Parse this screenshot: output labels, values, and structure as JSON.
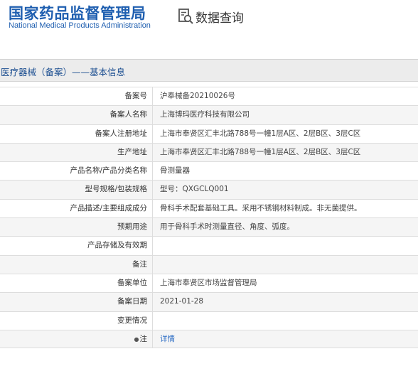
{
  "header": {
    "brand_cn": "国家药品监督管理局",
    "brand_en": "National Medical Products Administration",
    "query_label": "数据查询",
    "query_icon": "document-search-icon"
  },
  "page": {
    "title": "医疗器械（备案）——基本信息"
  },
  "rows": [
    {
      "label": "备案号",
      "value": "沪奉械备20210026号"
    },
    {
      "label": "备案人名称",
      "value": "上海博玛医疗科技有限公司"
    },
    {
      "label": "备案人注册地址",
      "value": "上海市奉贤区汇丰北路788号一幢1层A区、2层B区、3层C区"
    },
    {
      "label": "生产地址",
      "value": "上海市奉贤区汇丰北路788号一幢1层A区、2层B区、3层C区"
    },
    {
      "label": "产品名称/产品分类名称",
      "value": "骨测量器"
    },
    {
      "label": "型号规格/包装规格",
      "value": "型号：QXGCLQ001"
    },
    {
      "label": "产品描述/主要组成成分",
      "value": "骨科手术配套基础工具。采用不锈钢材料制成。非无菌提供。"
    },
    {
      "label": "预期用途",
      "value": "用于骨科手术时测量直径、角度、弧度。"
    },
    {
      "label": "产品存储及有效期",
      "value": ""
    },
    {
      "label": "备注",
      "value": ""
    },
    {
      "label": "备案单位",
      "value": "上海市奉贤区市场监督管理局"
    },
    {
      "label": "备案日期",
      "value": "2021-01-28"
    },
    {
      "label": "变更情况",
      "value": ""
    },
    {
      "label": "注",
      "value": "详情",
      "icon": "pin-icon"
    }
  ],
  "colors": {
    "brand": "#1f5fb0",
    "title_text": "#1d4f91",
    "link": "#2b6cc4"
  }
}
